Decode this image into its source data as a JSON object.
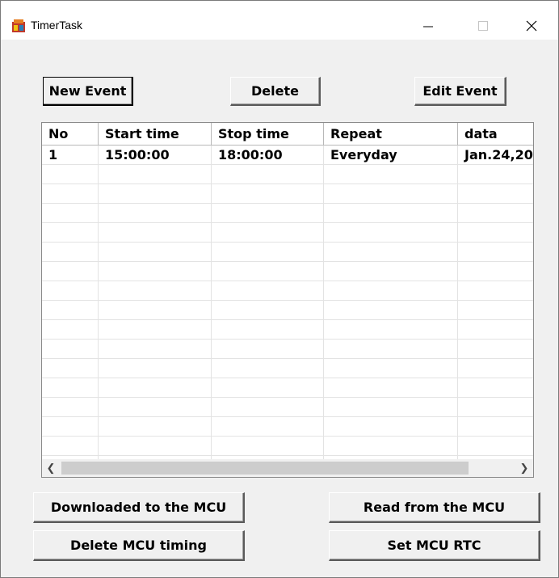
{
  "window": {
    "title": "TimerTask"
  },
  "toolbar": {
    "new_event": "New Event",
    "delete": "Delete",
    "edit_event": "Edit Event"
  },
  "table": {
    "columns": [
      "No",
      "Start time",
      "Stop time",
      "Repeat",
      "data"
    ],
    "rows": [
      [
        "1",
        "15:00:00",
        "18:00:00",
        "Everyday",
        "Jan.24,20"
      ]
    ]
  },
  "footer": {
    "download": "Downloaded to the MCU",
    "read": "Read from the MCU",
    "delete_timing": "Delete MCU timing",
    "set_rtc": "Set MCU RTC"
  },
  "icons": {
    "minimize": "minimize-icon",
    "maximize": "maximize-icon",
    "close": "close-icon"
  }
}
